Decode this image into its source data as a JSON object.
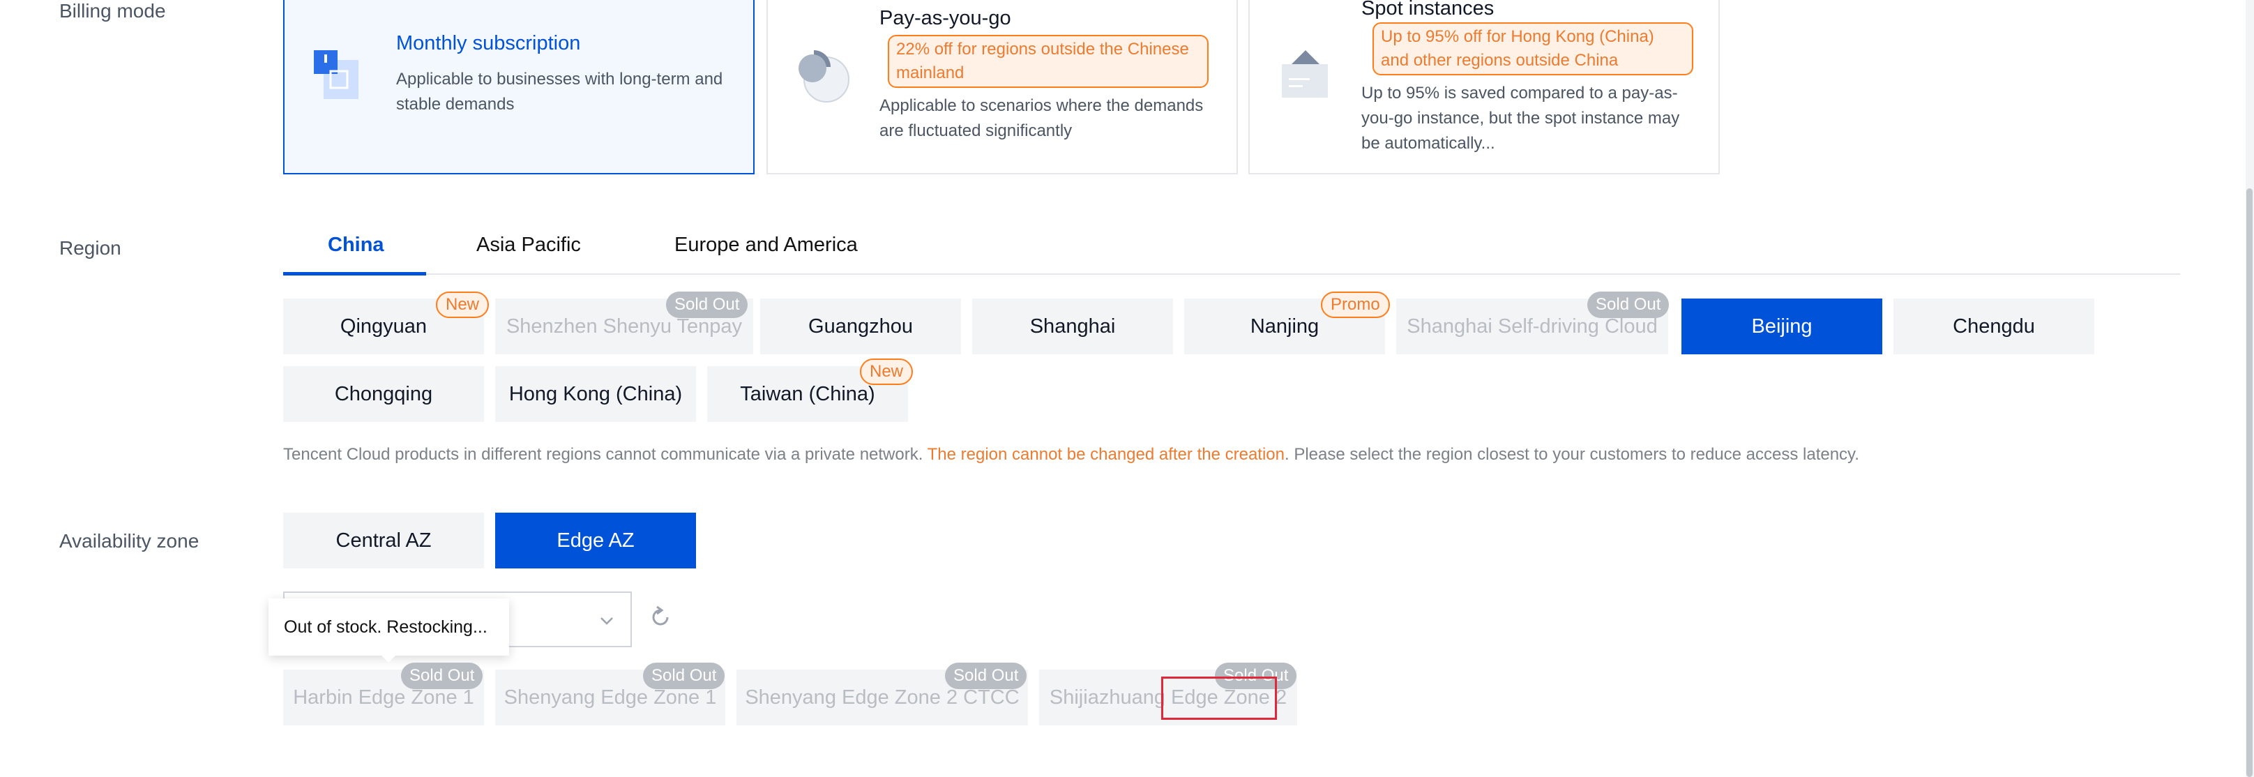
{
  "billing": {
    "label": "Billing mode",
    "cards": [
      {
        "title": "Monthly subscription",
        "desc": "Applicable to businesses with long-term and stable demands",
        "icon": "calendar-icon",
        "selected": true
      },
      {
        "title": "Pay-as-you-go",
        "promo": "22% off for regions outside the Chinese mainland",
        "desc": "Applicable to scenarios where the demands are fluctuated significantly",
        "icon": "pie-chart-icon"
      },
      {
        "title": "Spot instances",
        "promo": "Up to 95% off for Hong Kong (China) and other regions outside China",
        "desc": "Up to 95% is saved compared to a pay-as-you-go instance, but the spot instance may be automatically...",
        "icon": "spot-ticket-icon"
      }
    ]
  },
  "region": {
    "label": "Region",
    "tabs": [
      "China",
      "Asia Pacific",
      "Europe and America"
    ],
    "active_tab": "China",
    "buttons": [
      {
        "name": "Qingyuan",
        "badge": "New"
      },
      {
        "name": "Shenzhen Shenyu Tenpay",
        "badge": "Sold Out",
        "disabled": true
      },
      {
        "name": "Guangzhou"
      },
      {
        "name": "Shanghai"
      },
      {
        "name": "Nanjing",
        "badge": "Promo"
      },
      {
        "name": "Shanghai Self-driving Cloud",
        "badge": "Sold Out",
        "disabled": true
      },
      {
        "name": "Beijing",
        "selected": true
      },
      {
        "name": "Chengdu"
      },
      {
        "name": "Chongqing"
      },
      {
        "name": "Hong Kong (China)"
      },
      {
        "name": "Taiwan (China)",
        "badge": "New"
      }
    ],
    "note_before": "Tencent Cloud products in different regions cannot communicate via a private network. ",
    "note_warning": "The region cannot be changed after the creation",
    "note_after": ". Please select the region closest to your customers to reduce access latency."
  },
  "az": {
    "label": "Availability zone",
    "buttons": [
      "Central AZ",
      "Edge AZ"
    ],
    "active": "Edge AZ",
    "tooltip": "Out of stock. Restocking...",
    "zones": [
      {
        "name": "Harbin Edge Zone 1",
        "badge": "Sold Out"
      },
      {
        "name": "Shenyang Edge Zone 1",
        "badge": "Sold Out"
      },
      {
        "name": "Shenyang Edge Zone 2 CTCC",
        "badge": "Sold Out"
      },
      {
        "name": "Shijiazhuang Edge Zone 2",
        "badge": "Sold Out"
      }
    ]
  },
  "colors": {
    "primary": "#0052d9",
    "warning": "#ed7b2f",
    "disabled_text": "#b8bcc3",
    "button_bg": "#f3f4f6"
  }
}
